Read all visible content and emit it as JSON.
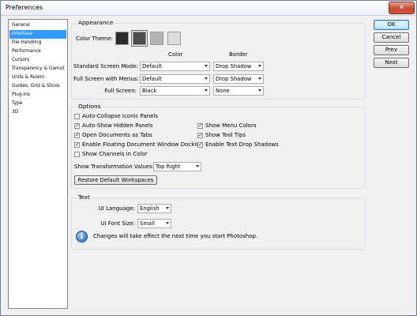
{
  "window": {
    "title": "Preferences",
    "close_glyph": "✕"
  },
  "sidebar": {
    "items": [
      {
        "label": "General",
        "selected": false
      },
      {
        "label": "Interface",
        "selected": true
      },
      {
        "label": "File Handling",
        "selected": false
      },
      {
        "label": "Performance",
        "selected": false
      },
      {
        "label": "Cursors",
        "selected": false
      },
      {
        "label": "Transparency & Gamut",
        "selected": false
      },
      {
        "label": "Units & Rulers",
        "selected": false
      },
      {
        "label": "Guides, Grid & Slices",
        "selected": false
      },
      {
        "label": "Plug-Ins",
        "selected": false
      },
      {
        "label": "Type",
        "selected": false
      },
      {
        "label": "3D",
        "selected": false
      }
    ]
  },
  "buttons": {
    "ok": "OK",
    "cancel": "Cancel",
    "prev": "Prev",
    "next": "Next"
  },
  "appearance": {
    "title": "Appearance",
    "color_theme_label": "Color Theme:",
    "swatches": [
      "#2b2b2b",
      "#4d4d4d",
      "#b4b4b4",
      "#dcdcdc"
    ],
    "col_color": "Color",
    "col_border": "Border",
    "rows": [
      {
        "label": "Standard Screen Mode:",
        "color": "Default",
        "border": "Drop Shadow"
      },
      {
        "label": "Full Screen with Menus:",
        "color": "Default",
        "border": "Drop Shadow"
      },
      {
        "label": "Full Screen:",
        "color": "Black",
        "border": "None"
      }
    ]
  },
  "options": {
    "title": "Options",
    "checks": [
      {
        "label": "Auto-Collapse Iconic Panels",
        "checked": false
      },
      {
        "label": "Auto-Show Hidden Panels",
        "checked": true
      },
      {
        "label": "Open Documents as Tabs",
        "checked": true
      },
      {
        "label": "Enable Floating Document Window Docking",
        "checked": true
      },
      {
        "label": "Show Channels in Color",
        "checked": false
      },
      {
        "label": "Show Menu Colors",
        "checked": true
      },
      {
        "label": "Show Tool Tips",
        "checked": true
      },
      {
        "label": "Enable Text Drop Shadows",
        "checked": true
      }
    ],
    "transform_label": "Show Transformation Values:",
    "transform_value": "Top Right",
    "restore_label": "Restore Default Workspaces"
  },
  "text_group": {
    "title": "Text",
    "ui_language_label": "UI Language:",
    "ui_language_value": "English",
    "ui_font_size_label": "UI Font Size:",
    "ui_font_size_value": "Small",
    "info_glyph": "i",
    "info_note": "Changes will take effect the next time you start Photoshop."
  }
}
